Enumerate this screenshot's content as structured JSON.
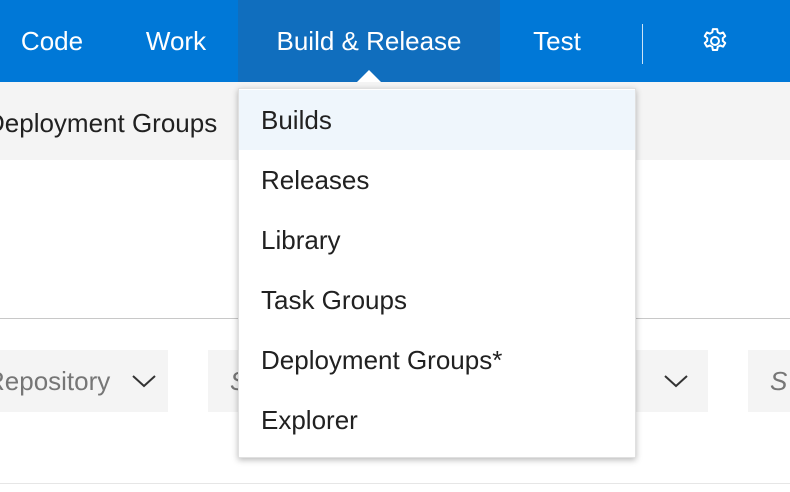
{
  "nav": {
    "items": [
      {
        "label": "Code"
      },
      {
        "label": "Work"
      },
      {
        "label": "Build & Release"
      },
      {
        "label": "Test"
      }
    ],
    "settings_icon": "gear-icon",
    "active_color": "#106ebe",
    "bar_color": "#0078d7"
  },
  "subnav": {
    "label": "Deployment Groups"
  },
  "filters": [
    {
      "text": "Repository",
      "icon": "chevron-down-icon"
    },
    {
      "text": "S",
      "icon": "chevron-down-icon"
    },
    {
      "text": "S"
    }
  ],
  "menu": {
    "items": [
      {
        "label": "Builds",
        "selected": true
      },
      {
        "label": "Releases"
      },
      {
        "label": "Library"
      },
      {
        "label": "Task Groups"
      },
      {
        "label": "Deployment Groups*"
      },
      {
        "label": "Explorer"
      }
    ],
    "highlight_color": "#eff6fc"
  }
}
